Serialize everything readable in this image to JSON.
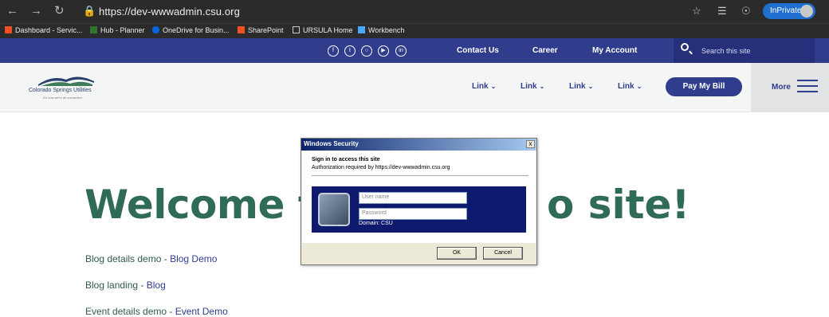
{
  "browser": {
    "url": "https://dev-wwwadmin.csu.org",
    "inprivate_label": "InPrivate",
    "bookmarks": [
      {
        "label": "Dashboard - Servic...",
        "color": "#f25022"
      },
      {
        "label": "Hub - Planner",
        "color": "#31752f"
      },
      {
        "label": "OneDrive for Busin...",
        "color": "#0a64d8"
      },
      {
        "label": "SharePoint",
        "color": "#f25022"
      },
      {
        "label": "URSULA Home",
        "color": "#cccccc"
      },
      {
        "label": "Workbench",
        "color": "#4aa8ff"
      }
    ]
  },
  "utility_bar": {
    "social_icons": [
      "facebook-icon",
      "twitter-icon",
      "instagram-icon",
      "youtube-icon",
      "linkedin-icon"
    ],
    "links": [
      "Contact Us",
      "Career",
      "My Account"
    ],
    "search_placeholder": "Search this site"
  },
  "header": {
    "logo_name": "Colorado Springs Utilities",
    "logo_tagline": "It's how we're all connected",
    "nav_links": [
      "Link",
      "Link",
      "Link",
      "Link"
    ],
    "pay_button": "Pay My Bill",
    "more_label": "More"
  },
  "content": {
    "heading_start": "Welcome t",
    "heading_end": "o site!",
    "links": [
      {
        "label": "Blog details demo - ",
        "link": "Blog Demo"
      },
      {
        "label": "Blog landing - ",
        "link": "Blog"
      },
      {
        "label": "Event details demo - ",
        "link": "Event Demo"
      }
    ]
  },
  "dialog": {
    "title": "Windows Security",
    "close": "x",
    "heading": "Sign in to access this site",
    "subtext": "Authorization required by https://dev-wwwadmin.csu.org",
    "username_placeholder": "User name",
    "password_placeholder": "Password",
    "domain": "Domain: CSU",
    "ok": "OK",
    "cancel": "Cancel"
  },
  "colors": {
    "brand_blue": "#303c8c",
    "brand_green": "#2f6b57"
  }
}
